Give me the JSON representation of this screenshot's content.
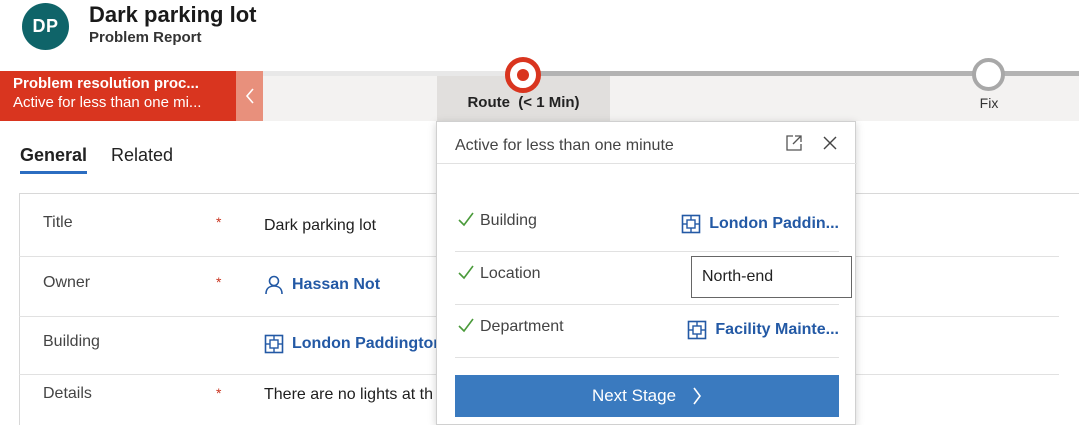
{
  "record": {
    "initials": "DP",
    "title": "Dark parking lot",
    "entity_type": "Problem Report"
  },
  "process": {
    "name": "Problem resolution proc...",
    "status": "Active for less than one mi...",
    "stages": [
      {
        "label": "Route  (< 1 Min)",
        "active": true
      },
      {
        "label": "Fix",
        "active": false
      }
    ],
    "accent_color": "#d9351f"
  },
  "tabs": [
    {
      "label": "General",
      "selected": true
    },
    {
      "label": "Related",
      "selected": false
    }
  ],
  "form": {
    "fields": [
      {
        "label": "Title",
        "required": "*",
        "value": "Dark parking lot"
      },
      {
        "label": "Owner",
        "required": "*",
        "value": "Hassan Not",
        "icon": "person-icon"
      },
      {
        "label": "Building",
        "required": "",
        "value": "London Paddington",
        "icon": "entity-record-icon"
      },
      {
        "label": "Details",
        "required": "*",
        "value": "There are no lights at th"
      }
    ]
  },
  "flyout": {
    "status": "Active for less than one minute",
    "steps": [
      {
        "label": "Building",
        "value": "London Paddin...",
        "icon": "entity-record-icon"
      },
      {
        "label": "Location",
        "value": "North-end"
      },
      {
        "label": "Department",
        "value": "Facility Mainte...",
        "icon": "entity-record-icon"
      }
    ],
    "next_label": "Next Stage"
  },
  "colors": {
    "link": "#2359a5",
    "button": "#3a7abf",
    "avatar": "#0f6469"
  }
}
